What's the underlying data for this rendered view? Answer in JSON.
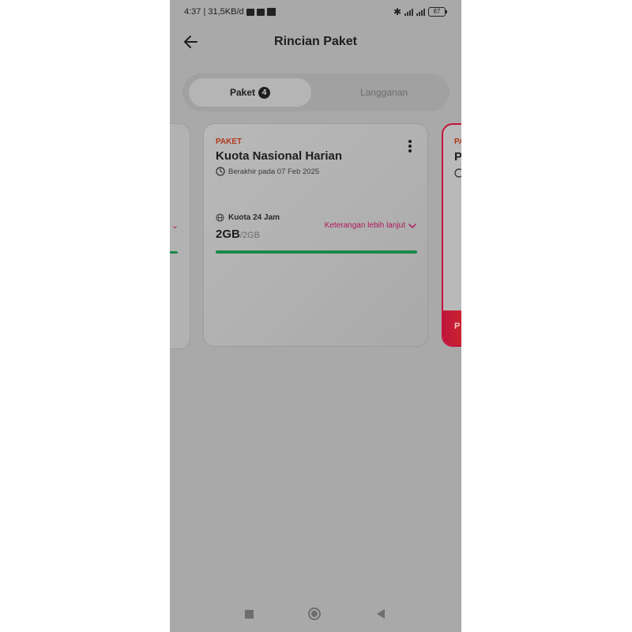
{
  "status_bar": {
    "time_speed": "4:37 | 31,5KB/d",
    "bluetooth": "✱",
    "battery": "87"
  },
  "header": {
    "title": "Rincian Paket",
    "back_icon": "arrow-left-icon"
  },
  "tabs": [
    {
      "label": "Paket",
      "badge": "4",
      "active": true
    },
    {
      "label": "Langganan",
      "active": false
    }
  ],
  "cards": {
    "main": {
      "kind": "PAKET",
      "title": "Kuota Nasional Harian",
      "expiry": "Berakhir pada 07 Feb 2025",
      "quota_label": "Kuota 24 Jam",
      "quota_remaining": "2GB",
      "quota_total": "/2GB",
      "more_info": "Keterangan lebih lanjut",
      "progress_fraction": 1.0
    },
    "right_partial": {
      "kind": "PA",
      "title": "P",
      "footer": "P"
    }
  },
  "colors": {
    "accent_magenta": "#b0185a",
    "progress_green": "#1b8a4a",
    "label_red": "#b0381e"
  }
}
